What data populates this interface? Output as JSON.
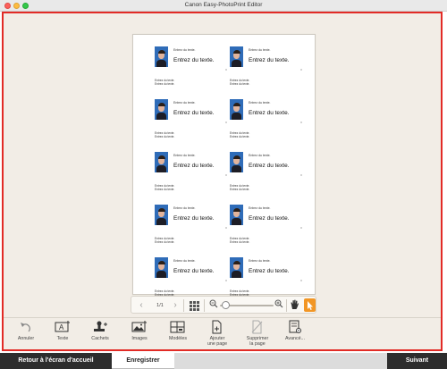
{
  "window": {
    "title": "Canon Easy-PhotoPrint Editor"
  },
  "page": {
    "card": {
      "small_text": "Entrez du texte.",
      "big_text": "Entrez du texte.",
      "line1": "Entrez du texte.",
      "line2": "Entrez du texte."
    },
    "rows": 5,
    "cols": 2
  },
  "navigation": {
    "prev_icon": "chevron-left-icon",
    "page_indicator": "1/1",
    "next_icon": "chevron-right-icon",
    "zoom_level": 0.05,
    "accent_color": "#f29625"
  },
  "toolbar": {
    "items": [
      {
        "label": "Annuler",
        "icon": "undo-icon"
      },
      {
        "label": "Texte",
        "icon": "text-icon"
      },
      {
        "label": "Cachets",
        "icon": "stamp-icon"
      },
      {
        "label": "Images",
        "icon": "images-icon"
      },
      {
        "label": "Modèles",
        "icon": "templates-icon"
      },
      {
        "label": "Ajouter\nune page",
        "icon": "add-page-icon"
      },
      {
        "label": "Supprimer\nla page",
        "icon": "delete-page-icon"
      },
      {
        "label": "Avancé...",
        "icon": "advanced-icon"
      }
    ]
  },
  "bottom": {
    "home_label": "Retour à l'écran d'accueil",
    "save_label": "Enregistrer",
    "next_label": "Suivant"
  },
  "colors": {
    "frame": "#e22b26",
    "background": "#f2ede6",
    "dark_button": "#2d2d2d"
  }
}
